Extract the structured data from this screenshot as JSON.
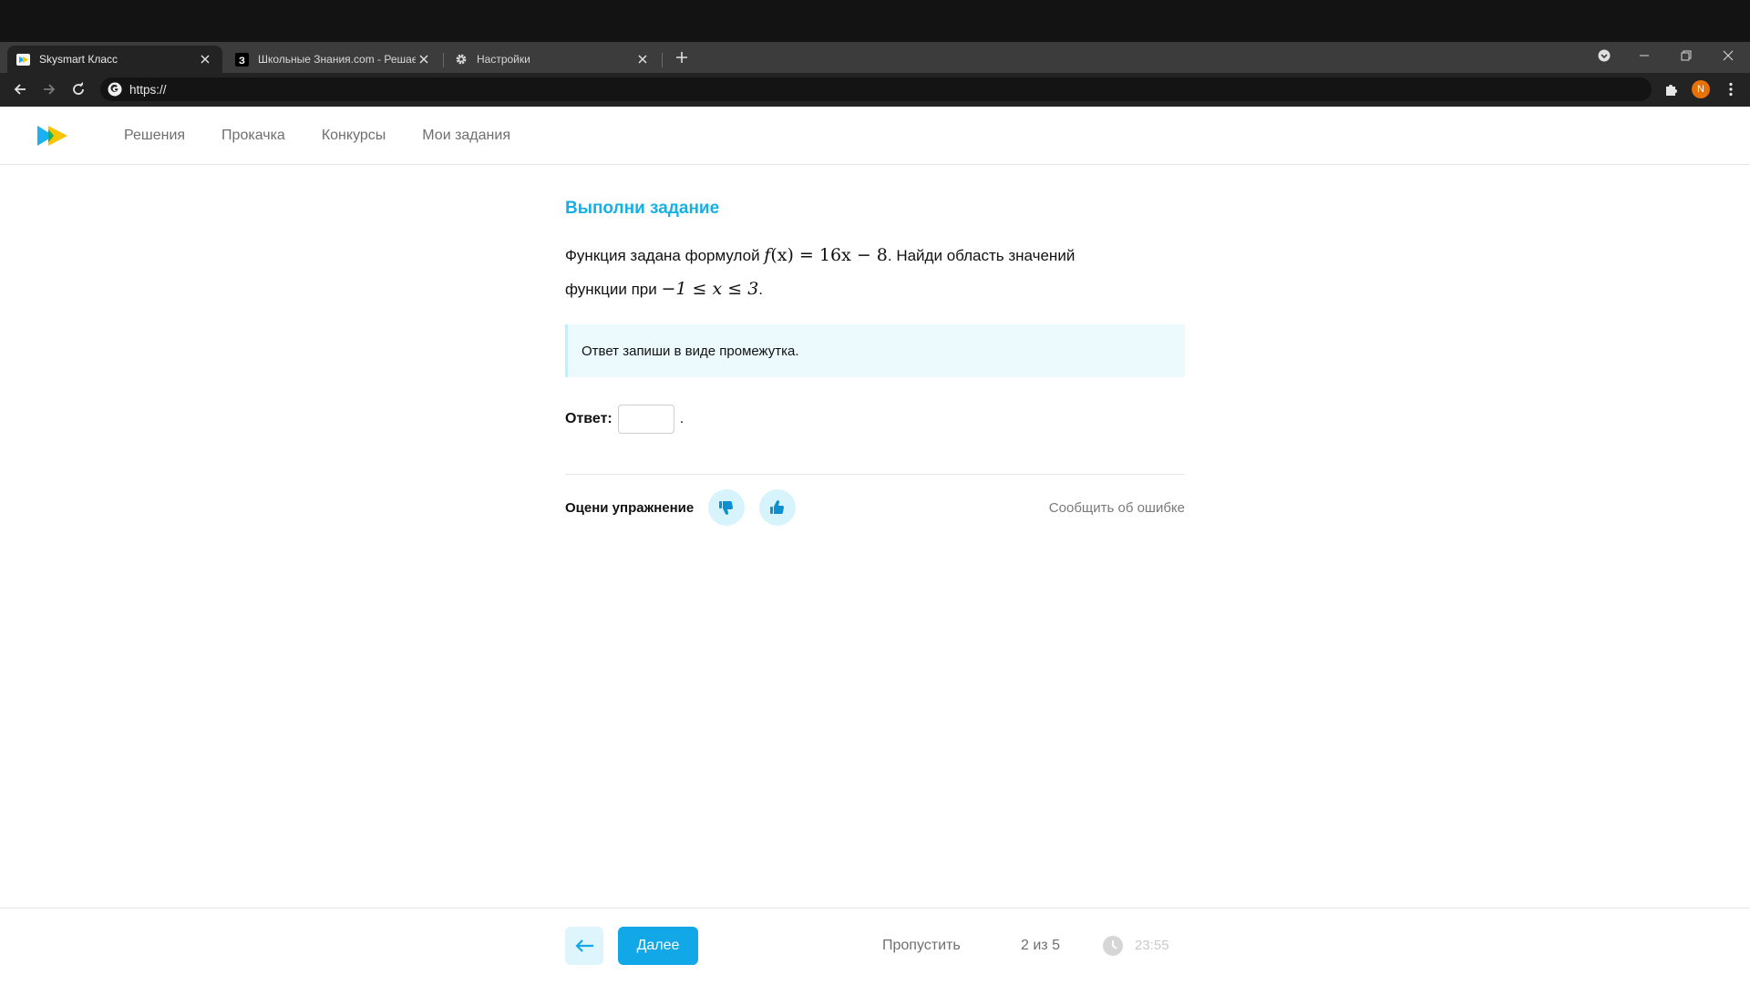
{
  "browser": {
    "tabs": [
      {
        "title": "Skysmart Класс",
        "icon": "skysmart-favicon"
      },
      {
        "title": "Школьные Знания.com - Решаем",
        "icon": "znanija-favicon"
      },
      {
        "title": "Настройки",
        "icon": "gear-icon"
      }
    ],
    "address": "https://",
    "profile_initial": "N"
  },
  "site": {
    "nav": [
      "Решения",
      "Прокачка",
      "Конкурсы",
      "Мои задания"
    ]
  },
  "task": {
    "title": "Выполни задание",
    "text_prefix": "Функция задана формулой",
    "formula_f": "f",
    "formula_rest": "(x) = 16x − 8",
    "text_middle": ". Найди область значений",
    "text_line2": "функции при",
    "condition": "−1 ≤ x ≤ 3",
    "text_end": ".",
    "hint": "Ответ запиши в виде промежутка.",
    "answer_label": "Ответ:",
    "answer_value": "",
    "answer_suffix": ".",
    "rate_label": "Оцени упражнение",
    "report_link": "Сообщить об ошибке"
  },
  "footer": {
    "next_label": "Далее",
    "skip_label": "Пропустить",
    "progress": "2 из 5",
    "timer": "23:55"
  },
  "colors": {
    "accent": "#14b1e7",
    "button": "#12a8e8",
    "hint_bg": "#ecfafd"
  }
}
